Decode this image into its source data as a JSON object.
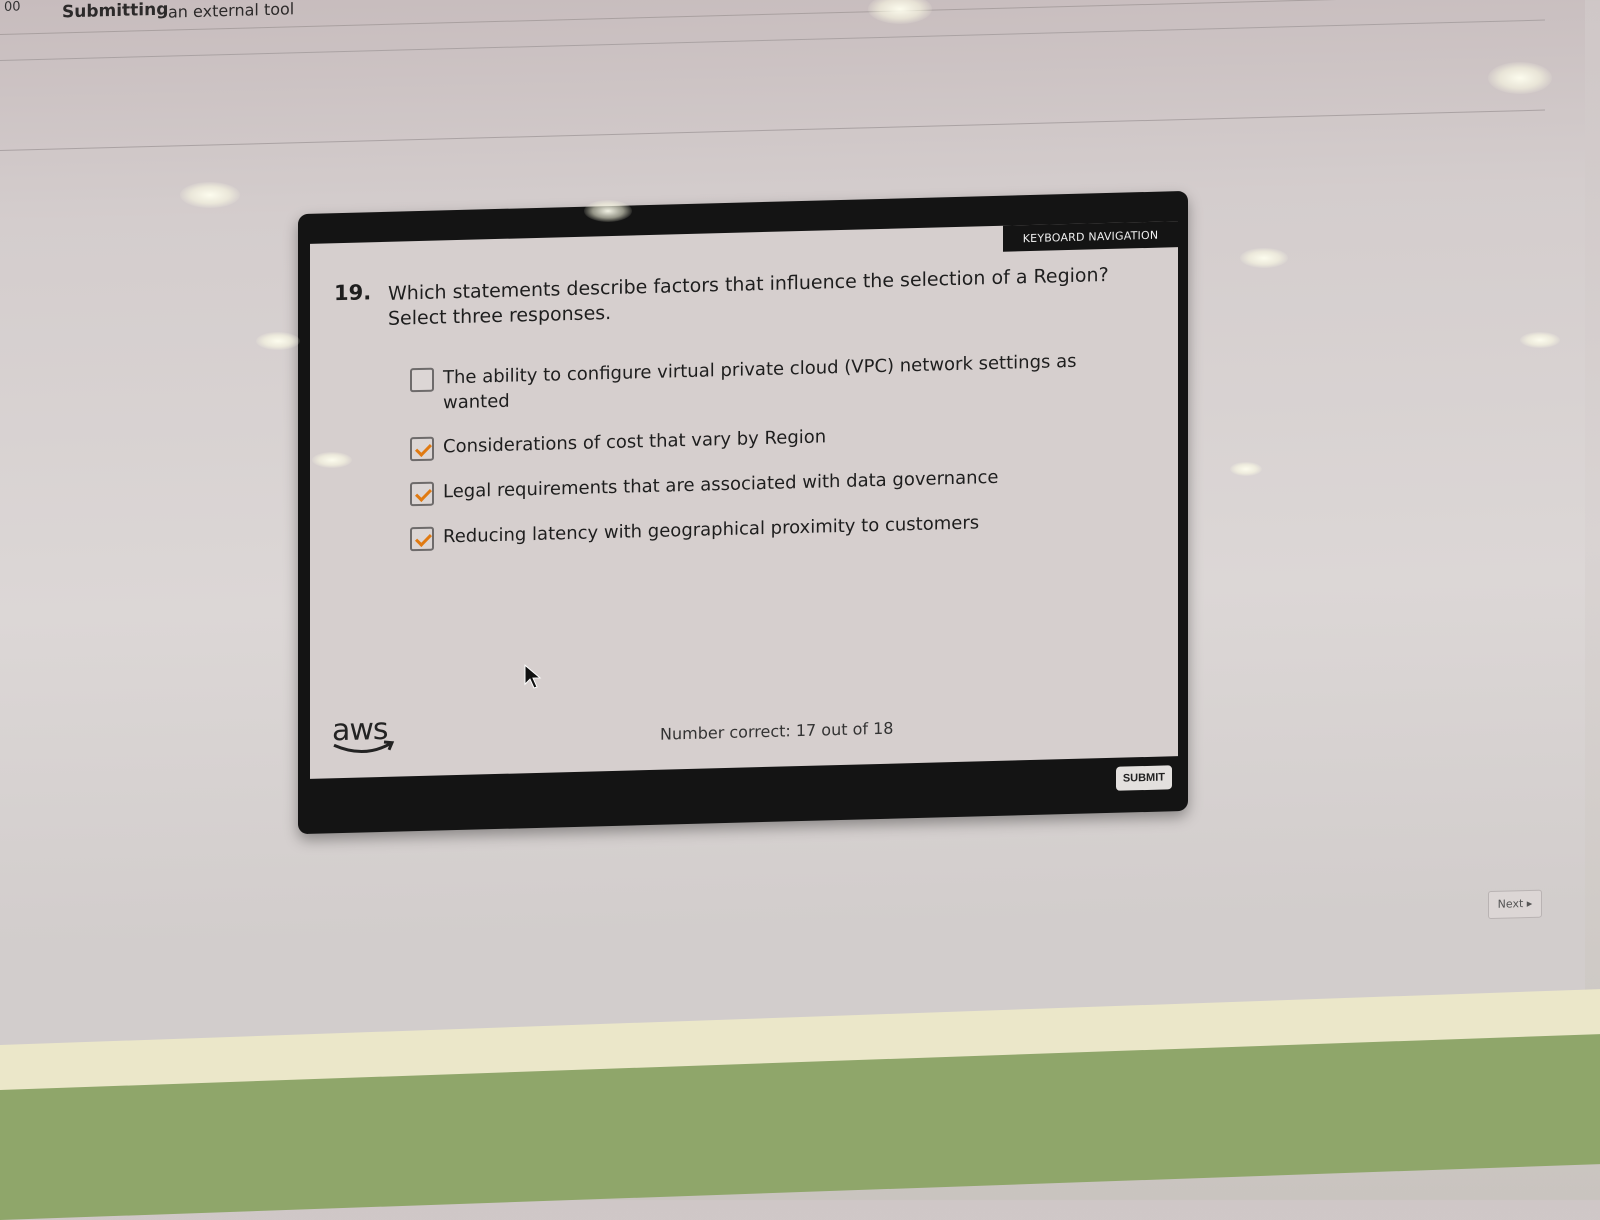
{
  "topbar": {
    "edge_text": "00",
    "status": "Submitting",
    "tool": "an external tool"
  },
  "quiz": {
    "keyboard_nav_label": "KEYBOARD NAVIGATION",
    "question_number": "19.",
    "question_text": "Which statements describe factors that influence the selection of a Region? Select three responses.",
    "options": [
      {
        "label": "The ability to configure virtual private cloud (VPC) network settings as wanted",
        "checked": false
      },
      {
        "label": "Considerations of cost that vary by Region",
        "checked": true
      },
      {
        "label": "Legal requirements that are associated with data governance",
        "checked": true
      },
      {
        "label": "Reducing latency with geographical proximity to customers",
        "checked": true
      }
    ],
    "logo_text": "aws",
    "score_text": "Number correct: 17 out of 18",
    "submit_label": "SUBMIT"
  },
  "nav": {
    "next_label": "Next ▸"
  },
  "colors": {
    "check_accent": "#e07a12",
    "module_frame": "#141414",
    "slide_bg": "#d6cfce"
  },
  "icons": [
    "checkbox-icon",
    "checkmark-icon",
    "aws-logo",
    "mouse-cursor-icon"
  ]
}
